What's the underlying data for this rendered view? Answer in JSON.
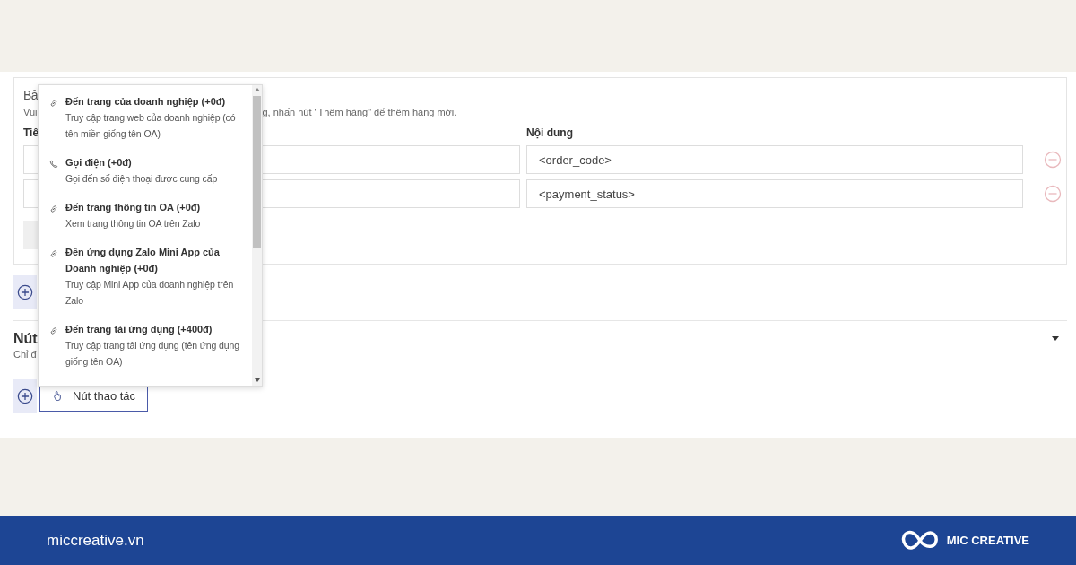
{
  "card": {
    "title": "Bả",
    "description_start": "Vui",
    "description_end": "g, nhấn nút \"Thêm hàng\" để thêm hàng mới.",
    "columns": [
      "Tiê",
      "Nội dung"
    ],
    "rows": [
      {
        "value": "<order_code>"
      },
      {
        "value": "<payment_status>"
      }
    ]
  },
  "section": {
    "title": "Nút",
    "subtitle": "Chỉ đ"
  },
  "action_button": {
    "label": "Nút thao tác"
  },
  "dropdown": {
    "items": [
      {
        "kind": "link",
        "title": "Đến trang của doanh nghiệp (+0đ)",
        "description": "Truy cập trang web của doanh nghiệp (có tên miền giống tên OA)"
      },
      {
        "kind": "phone",
        "title": "Gọi điện (+0đ)",
        "description": "Gọi đến số điện thoại được cung cấp"
      },
      {
        "kind": "link",
        "title": "Đến trang thông tin OA (+0đ)",
        "description": "Xem trang thông tin OA trên Zalo"
      },
      {
        "kind": "link",
        "title": "Đến ứng dụng Zalo Mini App của Doanh nghiệp (+0đ)",
        "description": "Truy cập Mini App của doanh nghiệp trên Zalo"
      },
      {
        "kind": "link",
        "title": "Đến trang tải ứng dụng (+400đ)",
        "description": "Truy cập trang tải ứng dụng (tên ứng dụng giống tên OA)"
      }
    ]
  },
  "footer": {
    "site": "miccreative.vn",
    "brand": "MIC CREATIVE"
  }
}
